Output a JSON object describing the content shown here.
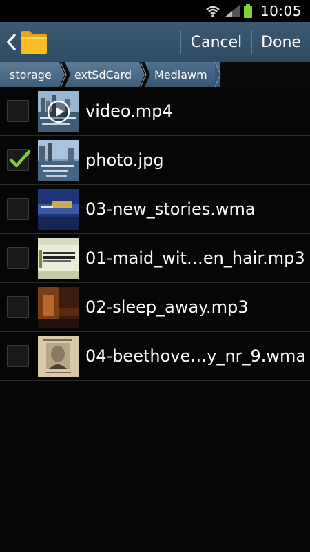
{
  "status_bar": {
    "time": "10:05"
  },
  "action_bar": {
    "cancel_label": "Cancel",
    "done_label": "Done"
  },
  "breadcrumb": [
    "storage",
    "extSdCard",
    "Mediawm"
  ],
  "files": [
    {
      "name": "video.mp4",
      "checked": false,
      "thumb": "video-harbor-thumbnail"
    },
    {
      "name": "photo.jpg",
      "checked": true,
      "thumb": "photo-harbor-thumbnail"
    },
    {
      "name": "03-new_stories.wma",
      "checked": false,
      "thumb": "blue-album-cover"
    },
    {
      "name": "01-maid_wit…en_hair.mp3",
      "checked": false,
      "thumb": "green-album-cover"
    },
    {
      "name": "02-sleep_away.mp3",
      "checked": false,
      "thumb": "piano-album-cover"
    },
    {
      "name": "04-beethove…y_nr_9.wma",
      "checked": false,
      "thumb": "beethoven-album-cover"
    }
  ],
  "colors": {
    "accent": "#3d5872",
    "check": "#7ad13a"
  }
}
